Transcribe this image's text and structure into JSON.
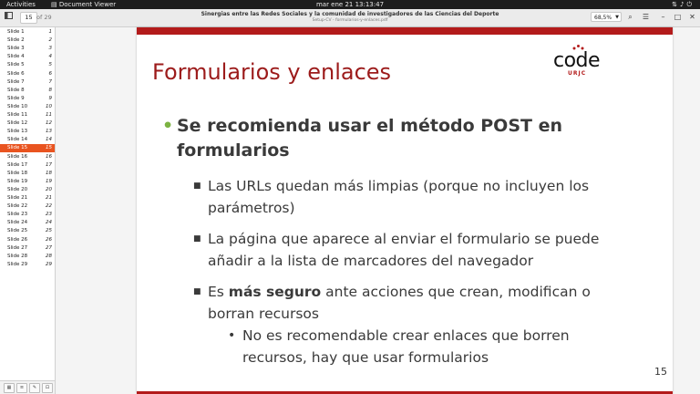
{
  "topbar": {
    "activities": "Activities",
    "app_name": "Document Viewer",
    "clock": "mar ene 21  13:13:47"
  },
  "header": {
    "page_current": "15",
    "page_total": "of 29",
    "title": "Sinergias entre las Redes Sociales y la comunidad de investigadores de las Ciencias del Deporte",
    "subtitle": "Setup-CV - formularios-y-enlaces.pdf",
    "zoom": "68,5%"
  },
  "sidebar": {
    "items": [
      {
        "label": "Slide 1",
        "num": "1"
      },
      {
        "label": "Slide 2",
        "num": "2"
      },
      {
        "label": "Slide 3",
        "num": "3"
      },
      {
        "label": "Slide 4",
        "num": "4"
      },
      {
        "label": "Slide 5",
        "num": "5"
      },
      {
        "label": "Slide 6",
        "num": "6"
      },
      {
        "label": "Slide 7",
        "num": "7"
      },
      {
        "label": "Slide 8",
        "num": "8"
      },
      {
        "label": "Slide 9",
        "num": "9"
      },
      {
        "label": "Slide 10",
        "num": "10"
      },
      {
        "label": "Slide 11",
        "num": "11"
      },
      {
        "label": "Slide 12",
        "num": "12"
      },
      {
        "label": "Slide 13",
        "num": "13"
      },
      {
        "label": "Slide 14",
        "num": "14"
      },
      {
        "label": "Slide 15",
        "num": "15"
      },
      {
        "label": "Slide 16",
        "num": "16"
      },
      {
        "label": "Slide 17",
        "num": "17"
      },
      {
        "label": "Slide 18",
        "num": "18"
      },
      {
        "label": "Slide 19",
        "num": "19"
      },
      {
        "label": "Slide 20",
        "num": "20"
      },
      {
        "label": "Slide 21",
        "num": "21"
      },
      {
        "label": "Slide 22",
        "num": "22"
      },
      {
        "label": "Slide 23",
        "num": "23"
      },
      {
        "label": "Slide 24",
        "num": "24"
      },
      {
        "label": "Slide 25",
        "num": "25"
      },
      {
        "label": "Slide 26",
        "num": "26"
      },
      {
        "label": "Slide 27",
        "num": "27"
      },
      {
        "label": "Slide 28",
        "num": "28"
      },
      {
        "label": "Slide 29",
        "num": "29"
      }
    ],
    "selected_index": 14
  },
  "slide": {
    "title": "Formularios y enlaces",
    "logo_text": "code",
    "logo_sub": "URJC",
    "bullet1": "Se recomienda usar el método POST en formularios",
    "sub1": "Las URLs quedan más limpias (porque no incluyen los parámetros)",
    "sub2": "La página que aparece al enviar el formulario se puede añadir a la lista de marcadores del navegador",
    "sub3_bold": "más seguro",
    "sub3_pre": "Es ",
    "sub3_post": " ante acciones que crean, modifican o borran recursos",
    "subsub1": "No es recomendable crear enlaces que borren recursos, hay que usar formularios",
    "page_number": "15"
  },
  "colors": {
    "accent": "#e95420",
    "brand_red": "#b31b1b",
    "bullet_green": "#7cb342"
  }
}
